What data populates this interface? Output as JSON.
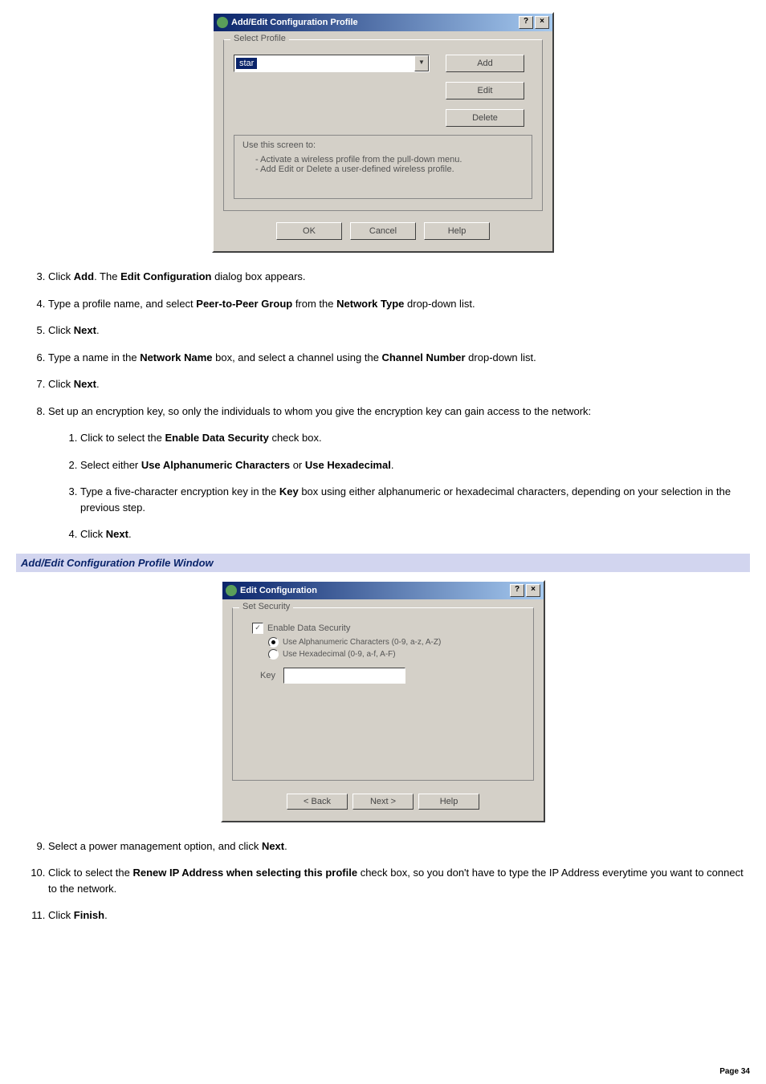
{
  "dialog1": {
    "title": "Add/Edit Configuration Profile",
    "help_btn": "?",
    "close_btn": "×",
    "select_profile_legend": "Select Profile",
    "combo_value": "star",
    "combo_arrow": "▼",
    "add_btn": "Add",
    "edit_btn": "Edit",
    "delete_btn": "Delete",
    "info_heading": "Use this screen to:",
    "info_line1": "- Activate a wireless profile from the pull-down menu.",
    "info_line2": "- Add Edit or Delete a user-defined wireless profile.",
    "ok_btn": "OK",
    "cancel_btn": "Cancel",
    "helpf_btn": "Help"
  },
  "steps": {
    "s3a": "Click ",
    "s3b": "Add",
    "s3c": ". The ",
    "s3d": "Edit Configuration",
    "s3e": " dialog box appears.",
    "s4a": "Type a profile name, and select ",
    "s4b": "Peer-to-Peer Group",
    "s4c": " from the ",
    "s4d": "Network Type",
    "s4e": " drop-down list.",
    "s5a": "Click ",
    "s5b": "Next",
    "s5c": ".",
    "s6a": "Type a name in the ",
    "s6b": "Network Name",
    "s6c": " box, and select a channel using the ",
    "s6d": "Channel Number",
    "s6e": " drop-down list.",
    "s7a": "Click ",
    "s7b": "Next",
    "s7c": ".",
    "s8": "Set up an encryption key, so only the individuals to whom you give the encryption key can gain access to the network:",
    "s8_1a": "Click to select the ",
    "s8_1b": "Enable Data Security",
    "s8_1c": " check box.",
    "s8_2a": "Select either ",
    "s8_2b": "Use Alphanumeric Characters",
    "s8_2c": " or ",
    "s8_2d": "Use Hexadecimal",
    "s8_2e": ".",
    "s8_3a": "Type a five-character encryption key in the ",
    "s8_3b": "Key",
    "s8_3c": " box using either alphanumeric or hexadecimal characters, depending on your selection in the previous step.",
    "s8_4a": "Click ",
    "s8_4b": "Next",
    "s8_4c": ".",
    "s9a": "Select a power management option, and click ",
    "s9b": "Next",
    "s9c": ".",
    "s10a": "Click to select the ",
    "s10b": "Renew IP Address when selecting this profile",
    "s10c": " check box, so you don't have to type the IP Address everytime you want to connect to the network.",
    "s11a": "Click ",
    "s11b": "Finish",
    "s11c": "."
  },
  "section_header": "Add/Edit Configuration Profile Window",
  "dialog2": {
    "title": "Edit Configuration",
    "help_btn": "?",
    "close_btn": "×",
    "set_security_legend": "Set Security",
    "enable_cb_label": "Enable Data Security",
    "radio1_label": "Use Alphanumeric Characters (0-9, a-z, A-Z)",
    "radio2_label": "Use Hexadecimal (0-9, a-f, A-F)",
    "key_label": "Key",
    "back_btn": "< Back",
    "next_btn": "Next >",
    "help_btn_footer": "Help"
  },
  "page_num": "Page 34"
}
